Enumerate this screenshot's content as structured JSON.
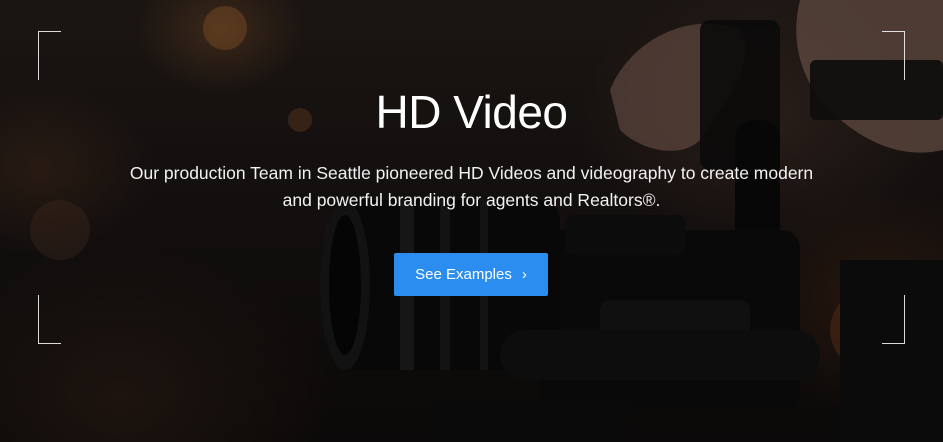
{
  "hero": {
    "title": "HD Video",
    "description_line1": "Our production Team in Seattle pioneered HD Videos and videography to create modern",
    "description_line2": "and powerful branding for agents and Realtors®.",
    "cta_label": "See Examples",
    "cta_icon": "chevron-right-icon",
    "cta_icon_glyph": "›"
  },
  "colors": {
    "cta_background": "#2b8df0",
    "text": "#ffffff",
    "frame_corners": "#ffffff"
  }
}
